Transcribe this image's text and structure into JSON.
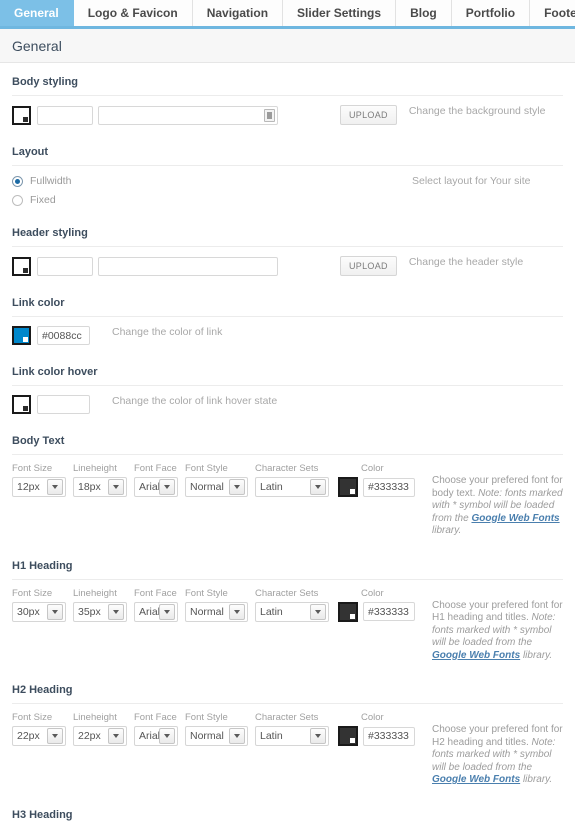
{
  "tabs": [
    {
      "label": "General",
      "active": true
    },
    {
      "label": "Logo & Favicon",
      "active": false
    },
    {
      "label": "Navigation",
      "active": false
    },
    {
      "label": "Slider Settings",
      "active": false
    },
    {
      "label": "Blog",
      "active": false
    },
    {
      "label": "Portfolio",
      "active": false
    },
    {
      "label": "Footer",
      "active": false
    }
  ],
  "panel": {
    "title": "General"
  },
  "sections": {
    "body_styling": {
      "label": "Body styling",
      "color_value": "",
      "upload_value": "",
      "upload_button": "UPLOAD",
      "description": "Change the background style"
    },
    "layout": {
      "label": "Layout",
      "options": [
        {
          "label": "Fullwidth",
          "checked": true
        },
        {
          "label": "Fixed",
          "checked": false
        }
      ],
      "description": "Select layout for Your site"
    },
    "header_styling": {
      "label": "Header styling",
      "color_value": "",
      "upload_value": "",
      "upload_button": "UPLOAD",
      "description": "Change the header style"
    },
    "link_color": {
      "label": "Link color",
      "value": "#0088cc",
      "swatch_color": "#0088cc",
      "description": "Change the color of link"
    },
    "link_color_hover": {
      "label": "Link color hover",
      "value": "",
      "swatch_color": "#ffffff",
      "description": "Change the color of link hover state"
    }
  },
  "field_labels": {
    "font_size": "Font Size",
    "lineheight": "Lineheight",
    "font_face": "Font Face",
    "font_style": "Font Style",
    "character_sets": "Character Sets",
    "color": "Color"
  },
  "note": {
    "prefix_body": "Choose your prefered font for body text.",
    "prefix_h1": "Choose your prefered font for H1 heading and titles.",
    "prefix_h2": "Choose your prefered font for H2 heading and titles.",
    "note_lead": "Note: fonts marked with * symbol will be loaded from the",
    "link": "Google Web Fonts",
    "suffix": "library."
  },
  "font_sections": [
    {
      "label": "Body Text",
      "font_size": "12px",
      "lineheight": "18px",
      "font_face": "Arial",
      "font_style": "Normal",
      "character_sets": "Latin",
      "color": "#333333",
      "swatch_color": "#333333",
      "desc_prefix": "Choose your prefered font for body text."
    },
    {
      "label": "H1 Heading",
      "font_size": "30px",
      "lineheight": "35px",
      "font_face": "Arial",
      "font_style": "Normal",
      "character_sets": "Latin",
      "color": "#333333",
      "swatch_color": "#333333",
      "desc_prefix": "Choose your prefered font for H1 heading and titles."
    },
    {
      "label": "H2 Heading",
      "font_size": "22px",
      "lineheight": "22px",
      "font_face": "Arial",
      "font_style": "Normal",
      "character_sets": "Latin",
      "color": "#333333",
      "swatch_color": "#333333",
      "desc_prefix": "Choose your prefered font for H2 heading and titles."
    }
  ],
  "truncated_section": {
    "label": "H3 Heading"
  }
}
